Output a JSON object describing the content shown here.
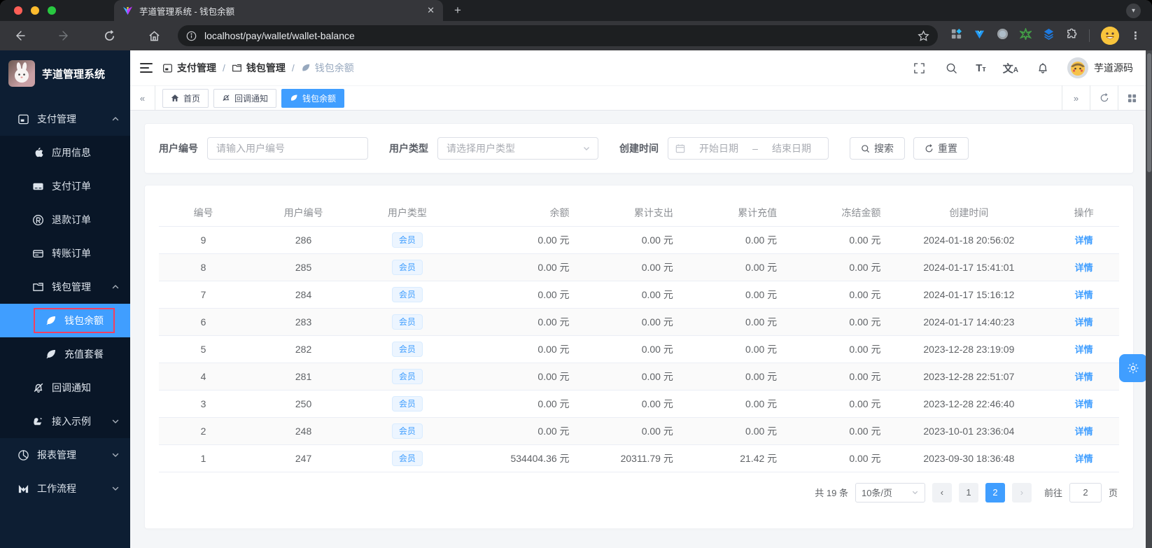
{
  "browser": {
    "tab_title": "芋道管理系统 - 钱包余额",
    "url": "localhost/pay/wallet/wallet-balance"
  },
  "sidebar": {
    "logo_title": "芋道管理系统",
    "menu": [
      {
        "label": "支付管理"
      },
      {
        "label": "应用信息"
      },
      {
        "label": "支付订单"
      },
      {
        "label": "退款订单"
      },
      {
        "label": "转账订单"
      },
      {
        "label": "钱包管理"
      },
      {
        "label": "钱包余额"
      },
      {
        "label": "充值套餐"
      },
      {
        "label": "回调通知"
      },
      {
        "label": "接入示例"
      },
      {
        "label": "报表管理"
      },
      {
        "label": "工作流程"
      }
    ]
  },
  "header": {
    "breadcrumb": [
      {
        "label": "支付管理"
      },
      {
        "label": "钱包管理"
      },
      {
        "label": "钱包余额"
      }
    ],
    "breadcrumb_separator": "/",
    "username": "芋道源码"
  },
  "tabs": [
    {
      "label": "首页"
    },
    {
      "label": "回调通知"
    },
    {
      "label": "钱包余额"
    }
  ],
  "filters": {
    "user_id_label": "用户编号",
    "user_id_placeholder": "请输入用户编号",
    "user_type_label": "用户类型",
    "user_type_placeholder": "请选择用户类型",
    "create_time_label": "创建时间",
    "start_date_placeholder": "开始日期",
    "range_separator": "–",
    "end_date_placeholder": "结束日期",
    "search_label": "搜索",
    "reset_label": "重置"
  },
  "table": {
    "columns": [
      "编号",
      "用户编号",
      "用户类型",
      "余额",
      "累计支出",
      "累计充值",
      "冻结金额",
      "创建时间",
      "操作"
    ],
    "rows": [
      {
        "id": "9",
        "user_id": "286",
        "user_type": "会员",
        "balance": "0.00 元",
        "total_expense": "0.00 元",
        "total_recharge": "0.00 元",
        "frozen_amount": "0.00 元",
        "create_time": "2024-01-18 20:56:02",
        "action": "详情"
      },
      {
        "id": "8",
        "user_id": "285",
        "user_type": "会员",
        "balance": "0.00 元",
        "total_expense": "0.00 元",
        "total_recharge": "0.00 元",
        "frozen_amount": "0.00 元",
        "create_time": "2024-01-17 15:41:01",
        "action": "详情"
      },
      {
        "id": "7",
        "user_id": "284",
        "user_type": "会员",
        "balance": "0.00 元",
        "total_expense": "0.00 元",
        "total_recharge": "0.00 元",
        "frozen_amount": "0.00 元",
        "create_time": "2024-01-17 15:16:12",
        "action": "详情"
      },
      {
        "id": "6",
        "user_id": "283",
        "user_type": "会员",
        "balance": "0.00 元",
        "total_expense": "0.00 元",
        "total_recharge": "0.00 元",
        "frozen_amount": "0.00 元",
        "create_time": "2024-01-17 14:40:23",
        "action": "详情"
      },
      {
        "id": "5",
        "user_id": "282",
        "user_type": "会员",
        "balance": "0.00 元",
        "total_expense": "0.00 元",
        "total_recharge": "0.00 元",
        "frozen_amount": "0.00 元",
        "create_time": "2023-12-28 23:19:09",
        "action": "详情"
      },
      {
        "id": "4",
        "user_id": "281",
        "user_type": "会员",
        "balance": "0.00 元",
        "total_expense": "0.00 元",
        "total_recharge": "0.00 元",
        "frozen_amount": "0.00 元",
        "create_time": "2023-12-28 22:51:07",
        "action": "详情"
      },
      {
        "id": "3",
        "user_id": "250",
        "user_type": "会员",
        "balance": "0.00 元",
        "total_expense": "0.00 元",
        "total_recharge": "0.00 元",
        "frozen_amount": "0.00 元",
        "create_time": "2023-12-28 22:46:40",
        "action": "详情"
      },
      {
        "id": "2",
        "user_id": "248",
        "user_type": "会员",
        "balance": "0.00 元",
        "total_expense": "0.00 元",
        "total_recharge": "0.00 元",
        "frozen_amount": "0.00 元",
        "create_time": "2023-10-01 23:36:04",
        "action": "详情"
      },
      {
        "id": "1",
        "user_id": "247",
        "user_type": "会员",
        "balance": "534404.36 元",
        "total_expense": "20311.79 元",
        "total_recharge": "21.42 元",
        "frozen_amount": "0.00 元",
        "create_time": "2023-09-30 18:36:48",
        "action": "详情"
      }
    ]
  },
  "pagination": {
    "total": "共 19 条",
    "page_size": "10条/页",
    "pages": [
      "1",
      "2"
    ],
    "active_page": "2",
    "goto_label": "前往",
    "goto_value": "2",
    "page_unit": "页"
  },
  "colors": {
    "accent": "#409eff",
    "active_highlight": "#f43f5e",
    "badge_bg": "#ecf5ff",
    "badge_border": "#d9ecff"
  }
}
